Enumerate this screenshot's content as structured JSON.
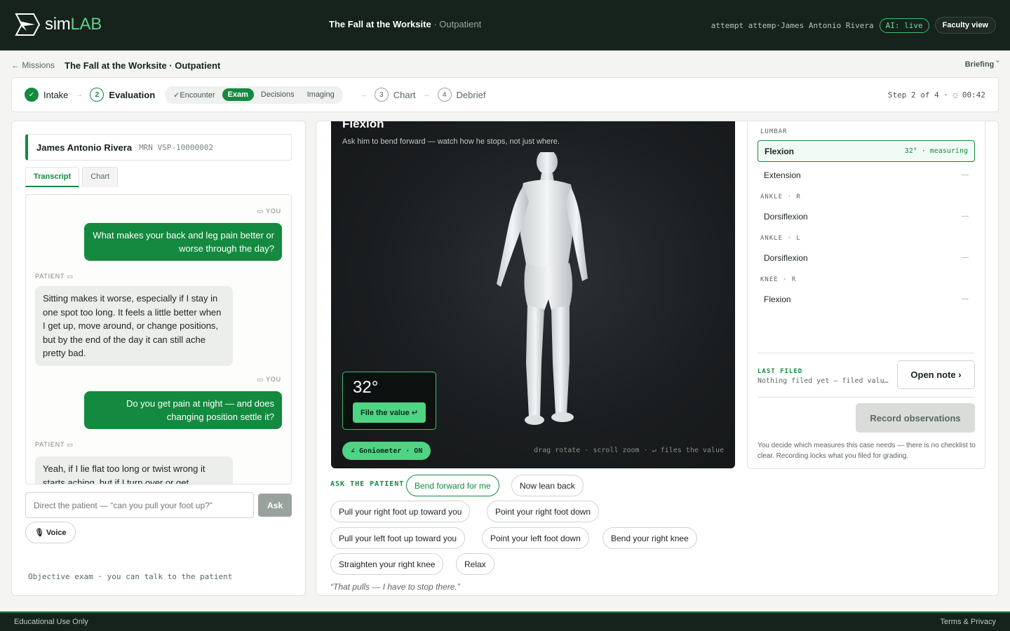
{
  "app": {
    "logo_prefix": "sim",
    "logo_suffix": "LAB"
  },
  "header": {
    "title": "The Fall at the Worksite",
    "subtitle": "· Outpatient",
    "attempt": "attempt attemp·James Antonio Rivera",
    "ai_status": "AI: live",
    "faculty_button": "Faculty view"
  },
  "breadcrumb": {
    "back": "← Missions",
    "title": "The Fall at the Worksite · Outpatient",
    "briefing": "Briefing ˇ"
  },
  "stepper": {
    "steps": [
      {
        "num": "✓",
        "label": "Intake",
        "state": "done"
      },
      {
        "num": "2",
        "label": "Evaluation",
        "state": "active"
      },
      {
        "num": "3",
        "label": "Chart",
        "state": "pending"
      },
      {
        "num": "4",
        "label": "Debrief",
        "state": "pending"
      }
    ],
    "subtabs": [
      "✓Encounter",
      "Exam",
      "Decisions",
      "Imaging"
    ],
    "active_subtab": "Exam",
    "meta": "Step 2 of 4 · ◌ 00:42"
  },
  "patient": {
    "name": "James Antonio Rivera",
    "mrn": "MRN VSP-10000002",
    "tabs": [
      "Transcript",
      "Chart"
    ]
  },
  "transcript": {
    "you_label": "▭ YOU",
    "patient_label": "PATIENT ▭",
    "messages": [
      {
        "from": "you",
        "text": "What makes your back and leg pain better or worse through the day?"
      },
      {
        "from": "patient",
        "text": "Sitting makes it worse, especially if I stay in one spot too long. It feels a little better when I get up, move around, or change positions, but by the end of the day it can still ache pretty bad."
      },
      {
        "from": "you",
        "text": "Do you get pain at night — and does changing position settle it?"
      },
      {
        "from": "patient",
        "text": "Yeah, if I lie flat too long or twist wrong it starts aching, but if I turn over or get"
      }
    ]
  },
  "ask": {
    "placeholder": "Direct the patient — “can you pull your foot up?”",
    "button": "Ask",
    "voice": "🎙 Voice",
    "footer": "Objective exam · you can talk to the patient"
  },
  "viewer": {
    "title": "Flexion",
    "instruction": "Ask him to bend forward — watch how he stops, not just where.",
    "reading": "32°",
    "file_button": "File the value ↵",
    "goniometer": "∠ Goniometer · ON",
    "hint": "drag rotate · scroll zoom · ↵ files the value"
  },
  "ask_patient": {
    "label": "ASK THE PATIENT",
    "chips": [
      "Bend forward for me",
      "Now lean back",
      "Pull your right foot up toward you",
      "Point your right foot down",
      "Pull your left foot up toward you",
      "Point your left foot down",
      "Bend your right knee",
      "Straighten your right knee",
      "Relax"
    ],
    "selected": "Bend forward for me",
    "quote": "“That pulls — I have to stop there.”"
  },
  "measures": {
    "groups": [
      {
        "label": "LUMBAR",
        "rows": [
          {
            "name": "Flexion",
            "value": "32° · measuring",
            "active": true
          },
          {
            "name": "Extension",
            "value": "—"
          }
        ]
      },
      {
        "label": "ANKLE · R",
        "rows": [
          {
            "name": "Dorsiflexion",
            "value": "—"
          }
        ]
      },
      {
        "label": "ANKLE · L",
        "rows": [
          {
            "name": "Dorsiflexion",
            "value": "—"
          }
        ]
      },
      {
        "label": "KNEE · R",
        "rows": [
          {
            "name": "Flexion",
            "value": "—"
          }
        ]
      }
    ],
    "last_filed_label": "LAST FILED",
    "last_filed_text": "Nothing filed yet — filed values appear here",
    "open_note": "Open note ›",
    "record_button": "Record observations",
    "note": "You decide which measures this case needs — there is no checklist to clear. Recording locks what you filed for grading."
  },
  "footer": {
    "left": "Educational Use Only",
    "right": "Terms & Privacy"
  },
  "colors": {
    "accent": "#138a3f",
    "accent_light": "#4fd484",
    "topbar": "#16221c"
  }
}
